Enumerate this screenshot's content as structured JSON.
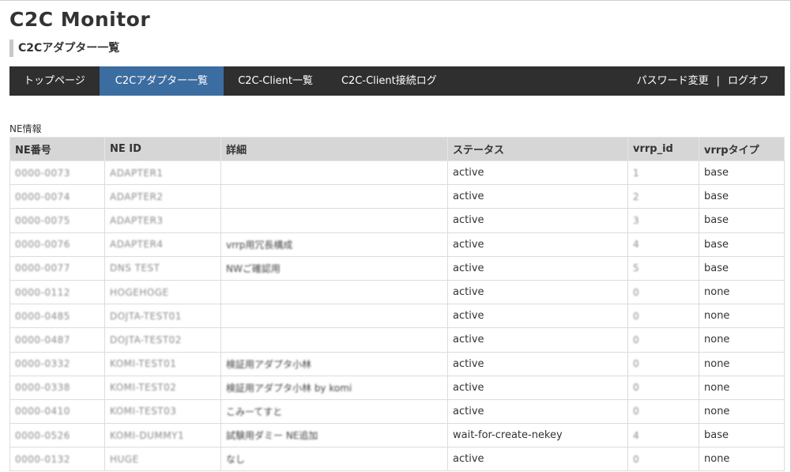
{
  "app": {
    "title": "C2C Monitor"
  },
  "page": {
    "subtitle": "C2Cアダプター一覧"
  },
  "nav": {
    "items": [
      "トップページ",
      "C2Cアダプター一覧",
      "C2C-Client一覧",
      "C2C-Client接続ログ"
    ],
    "active_index": 1,
    "right": {
      "password": "パスワード変更",
      "separator": "|",
      "logout": "ログオフ"
    }
  },
  "section": {
    "label": "NE情報"
  },
  "table": {
    "headers": [
      "NE番号",
      "NE ID",
      "詳細",
      "ステータス",
      "vrrp_id",
      "vrrpタイプ"
    ],
    "rows": [
      [
        "0000-0073",
        "ADAPTER1",
        "",
        "active",
        "1",
        "base"
      ],
      [
        "0000-0074",
        "ADAPTER2",
        "",
        "active",
        "2",
        "base"
      ],
      [
        "0000-0075",
        "ADAPTER3",
        "",
        "active",
        "3",
        "base"
      ],
      [
        "0000-0076",
        "ADAPTER4",
        "vrrp用冗長構成",
        "active",
        "4",
        "base"
      ],
      [
        "0000-0077",
        "DNS TEST",
        "NWご確認用",
        "active",
        "5",
        "base"
      ],
      [
        "0000-0112",
        "HOGEHOGE",
        "",
        "active",
        "0",
        "none"
      ],
      [
        "0000-0485",
        "DOJTA-TEST01",
        "",
        "active",
        "0",
        "none"
      ],
      [
        "0000-0487",
        "DOJTA-TEST02",
        "",
        "active",
        "0",
        "none"
      ],
      [
        "0000-0332",
        "KOMI-TEST01",
        "検証用アダプタ小林",
        "active",
        "0",
        "none"
      ],
      [
        "0000-0338",
        "KOMI-TEST02",
        "検証用アダプタ小林 by komi",
        "active",
        "0",
        "none"
      ],
      [
        "0000-0410",
        "KOMI-TEST03",
        "こみーてすと",
        "active",
        "0",
        "none"
      ],
      [
        "0000-0526",
        "KOMI-DUMMY1",
        "試験用ダミー NE追加",
        "wait-for-create-nekey",
        "4",
        "base"
      ],
      [
        "0000-0132",
        "HUGE",
        "なし",
        "active",
        "0",
        "none"
      ]
    ]
  }
}
